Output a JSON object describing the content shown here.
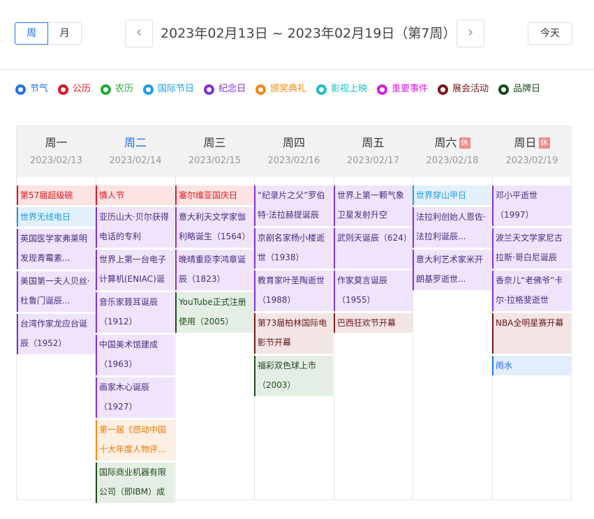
{
  "header": {
    "week_label": "周",
    "month_label": "月",
    "range_text": "2023年02月13日 ~ 2023年02月19日（第7周）",
    "today_label": "今天",
    "prev_icon": "‹",
    "next_icon": "›"
  },
  "legend": [
    {
      "label": "节气",
      "color": "#1a73e8"
    },
    {
      "label": "公历",
      "color": "#e0141e"
    },
    {
      "label": "农历",
      "color": "#1aaa35"
    },
    {
      "label": "国际节日",
      "color": "#1b9be8"
    },
    {
      "label": "纪念日",
      "color": "#7b2fe0"
    },
    {
      "label": "颁奖典礼",
      "color": "#f5870f"
    },
    {
      "label": "影视上映",
      "color": "#19bfc4"
    },
    {
      "label": "重要事件",
      "color": "#d522e0"
    },
    {
      "label": "展会活动",
      "color": "#7a1616"
    },
    {
      "label": "品牌日",
      "color": "#164a16"
    }
  ],
  "days": [
    {
      "name": "周一",
      "date": "2023/02/13",
      "rest": ""
    },
    {
      "name": "周二",
      "date": "2023/02/14",
      "rest": ""
    },
    {
      "name": "周三",
      "date": "2023/02/15",
      "rest": ""
    },
    {
      "name": "周四",
      "date": "2023/02/16",
      "rest": ""
    },
    {
      "name": "周五",
      "date": "2023/02/17",
      "rest": ""
    },
    {
      "name": "周六",
      "date": "2023/02/18",
      "rest": "休"
    },
    {
      "name": "周日",
      "date": "2023/02/19",
      "rest": "休"
    }
  ],
  "events": [
    [
      {
        "text": "第57届超级碗",
        "type": "gongli"
      },
      {
        "text": "世界无线电日",
        "type": "guoji"
      },
      {
        "text": "英国医学家弗莱明发现青霉素...",
        "type": "jinian"
      },
      {
        "text": "美国第一夫人贝丝·杜鲁门诞辰...",
        "type": "jinian"
      },
      {
        "text": "台湾作家龙应台诞辰（1952）",
        "type": "jinian"
      }
    ],
    [
      {
        "text": "情人节",
        "type": "gongli"
      },
      {
        "text": "亚历山大·贝尔获得电话的专利",
        "type": "jinian"
      },
      {
        "text": "世界上第一台电子计算机(ENIAC)诞生",
        "type": "jinian"
      },
      {
        "text": "音乐家聂耳诞辰（1912）",
        "type": "jinian"
      },
      {
        "text": "中国美术馆建成（1963）",
        "type": "jinian"
      },
      {
        "text": "画家木心诞辰（1927）",
        "type": "jinian"
      },
      {
        "text": "第一届《感动中国十大年度人物评...",
        "type": "banjiang"
      },
      {
        "text": "国际商业机器有限公司（即IBM）成立",
        "type": "pinpai"
      }
    ],
    [
      {
        "text": "塞尔维亚国庆日",
        "type": "gongli"
      },
      {
        "text": "意大利天文学家伽利略诞生（1564）",
        "type": "jinian"
      },
      {
        "text": "晚晴重臣李鸿章诞辰（1823）",
        "type": "jinian"
      },
      {
        "text": "YouTube正式注册使用（2005）",
        "type": "pinpai"
      }
    ],
    [
      {
        "text": "“纪录片之父”罗伯特·法拉赫提诞辰",
        "type": "jinian"
      },
      {
        "text": "京剧名家杨小楼逝世（1938）",
        "type": "jinian"
      },
      {
        "text": "教育家叶圣陶逝世（1988）",
        "type": "jinian"
      },
      {
        "text": "第73届柏林国际电影节开幕",
        "type": "zhanhui"
      },
      {
        "text": "福彩双色球上市（2003）",
        "type": "pinpai"
      }
    ],
    [
      {
        "text": "世界上第一颗气象卫星发射升空",
        "type": "jinian"
      },
      {
        "text": "武则天诞辰（624）",
        "type": "jinian"
      },
      {
        "text": "作家莫言诞辰（1955）",
        "type": "jinian"
      },
      {
        "text": "巴西狂欢节开幕",
        "type": "zhanhui"
      }
    ],
    [
      {
        "text": "世界穿山甲日",
        "type": "guoji"
      },
      {
        "text": "法拉利创始人恩佐·法拉利诞辰...",
        "type": "jinian"
      },
      {
        "text": "意大利艺术家米开朗基罗逝世...",
        "type": "jinian"
      }
    ],
    [
      {
        "text": "邓小平逝世（1997）",
        "type": "jinian"
      },
      {
        "text": "波兰天文学家尼古拉斯·哥白尼诞辰",
        "type": "jinian"
      },
      {
        "text": "香奈儿“老佛爷”卡尔·拉格斐逝世",
        "type": "jinian"
      },
      {
        "text": "NBA全明星赛开幕",
        "type": "zhanhui"
      },
      {
        "text": "雨水",
        "type": "jieqi"
      }
    ]
  ]
}
